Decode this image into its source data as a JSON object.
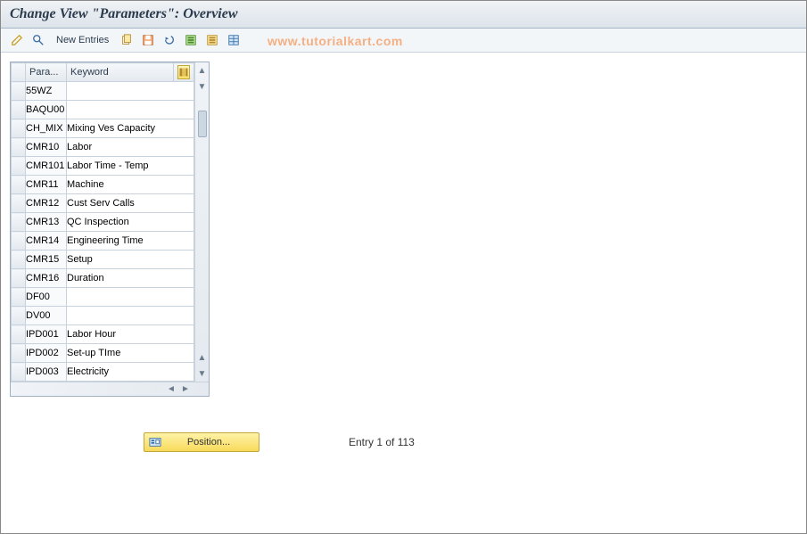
{
  "title": "Change View \"Parameters\": Overview",
  "watermark": "www.tutorialkart.com",
  "toolbar": {
    "new_entries": "New Entries"
  },
  "grid": {
    "headers": {
      "para": "Para...",
      "keyword": "Keyword"
    },
    "rows": [
      {
        "para": "55WZ",
        "keyword": ""
      },
      {
        "para": "BAQU00",
        "keyword": ""
      },
      {
        "para": "CH_MIX",
        "keyword": "Mixing Ves Capacity"
      },
      {
        "para": "CMR10",
        "keyword": "Labor"
      },
      {
        "para": "CMR101",
        "keyword": "Labor Time - Temp"
      },
      {
        "para": "CMR11",
        "keyword": "Machine"
      },
      {
        "para": "CMR12",
        "keyword": "Cust Serv Calls"
      },
      {
        "para": "CMR13",
        "keyword": "QC Inspection"
      },
      {
        "para": "CMR14",
        "keyword": "Engineering Time"
      },
      {
        "para": "CMR15",
        "keyword": "Setup"
      },
      {
        "para": "CMR16",
        "keyword": "Duration"
      },
      {
        "para": "DF00",
        "keyword": ""
      },
      {
        "para": "DV00",
        "keyword": ""
      },
      {
        "para": "IPD001",
        "keyword": "Labor Hour"
      },
      {
        "para": "IPD002",
        "keyword": "Set-up TIme"
      },
      {
        "para": "IPD003",
        "keyword": "Electricity"
      }
    ]
  },
  "footer": {
    "position_label": "Position...",
    "entry_status": "Entry 1 of 113"
  }
}
